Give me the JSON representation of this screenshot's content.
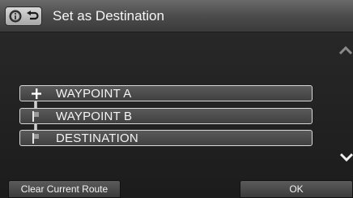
{
  "header": {
    "title": "Set as Destination",
    "info_icon": "info-icon",
    "back_icon": "return-arrow-icon"
  },
  "route": {
    "items": [
      {
        "label": "WAYPOINT A",
        "icon": "plus-icon"
      },
      {
        "label": "WAYPOINT B",
        "icon": "flag-icon"
      },
      {
        "label": "DESTINATION",
        "icon": "flag-icon"
      }
    ]
  },
  "scroll": {
    "up_icon": "chevron-up-icon",
    "down_icon": "chevron-down-icon"
  },
  "footer": {
    "clear_label": "Clear Current Route",
    "ok_label": "OK"
  },
  "colors": {
    "title_bar": "#4c4c4c",
    "background": "#222222",
    "row_border": "#d8d8d8"
  }
}
